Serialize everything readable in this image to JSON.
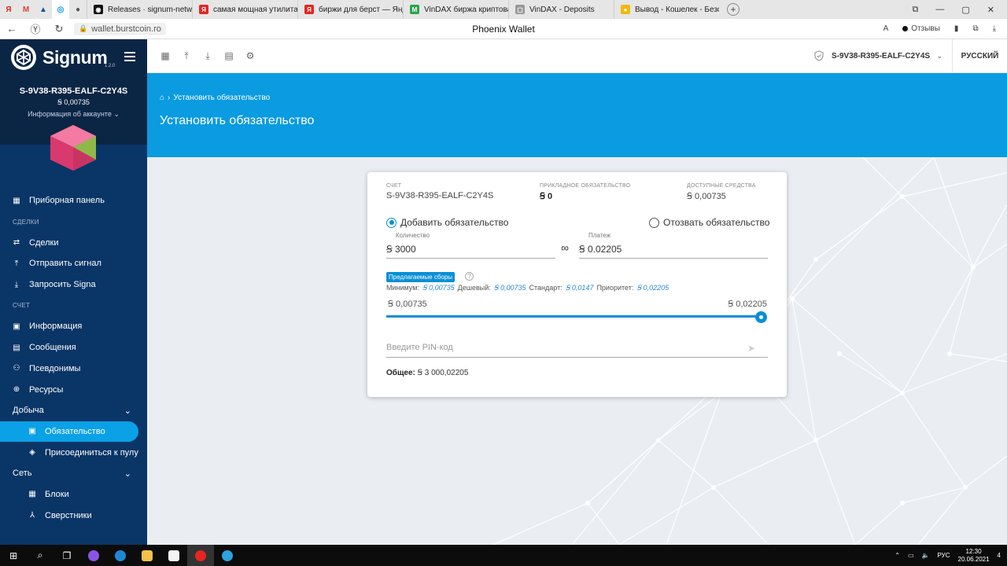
{
  "browser": {
    "pinned": [
      {
        "label": "Я",
        "color": "#e52620"
      },
      {
        "label": "M",
        "color": "#d44638"
      },
      {
        "label": "▲",
        "color": "#1a4fa0"
      },
      {
        "label": "◎",
        "color": "#0a9be1"
      },
      {
        "label": "●",
        "color": "#555555"
      }
    ],
    "tabs": [
      {
        "label": "Releases · signum-network",
        "fav": "◉",
        "fav_color": "#111111"
      },
      {
        "label": "самая мощная утилита для",
        "fav": "Я",
        "fav_color": "#e52620"
      },
      {
        "label": "биржи для берст — Яндекс",
        "fav": "Я",
        "fav_color": "#e52620"
      },
      {
        "label": "VinDAX биржа криптовалют",
        "fav": "M",
        "fav_color": "#2ca44e"
      },
      {
        "label": "VinDAX - Deposits",
        "fav": "▢",
        "fav_color": "#999999"
      },
      {
        "label": "Вывод - Кошелек - Безопа",
        "fav": "●",
        "fav_color": "#f0b90b"
      }
    ],
    "new_tab": "+",
    "window_controls": [
      "⧉",
      "—",
      "▢",
      "✕"
    ],
    "url": "wallet.burstcoin.ro",
    "page_title": "Phoenix Wallet",
    "reviews": "Отзывы"
  },
  "sidebar": {
    "logo": "Signum",
    "version": "1.2.0",
    "account_id": "S-9V38-R395-EALF-C2Y4S",
    "balance": "Ꞩ 0,00735",
    "account_info": "Информация об аккаунте ⌄",
    "dashboard": "Приборная панель",
    "section_deals": "СДЕЛКИ",
    "deals": "Сделки",
    "send": "Отправить сигнал",
    "request": "Запросить Signa",
    "section_account": "СЧЕТ",
    "info": "Информация",
    "messages": "Сообщения",
    "aliases": "Псевдонимы",
    "assets": "Ресурсы",
    "mining": "Добыча",
    "commitment": "Обязательство",
    "join_pool": "Присоединиться к пулу",
    "network": "Сеть",
    "blocks": "Блоки",
    "peers": "Сверстники"
  },
  "topbar": {
    "account": "S-9V38-R395-EALF-C2Y4S",
    "language": "РУССКИЙ"
  },
  "hero": {
    "breadcrumb": "Установить обязательство",
    "title": "Установить обязательство"
  },
  "form": {
    "account_label": "СЧЕТ",
    "account_value": "S-9V38-R395-EALF-C2Y4S",
    "committed_label": "ПРИКЛАДНОЕ ОБЯЗАТЕЛЬСТВО",
    "committed_value": "Ꞩ 0",
    "available_label": "ДОСТУПНЫЕ СРЕДСТВА",
    "available_value": "Ꞩ 0,00735",
    "add_label": "Добавить обязательство",
    "revoke_label": "Отозвать обязательство",
    "add_selected": true,
    "amount_label": "Количество",
    "amount_value": "Ꞩ 3000",
    "infinity": "∞",
    "fee_label": "Платеж",
    "fee_value": "Ꞩ 0.02205",
    "suggested_fees": "Предлагаемые сборы",
    "help": "?",
    "min_label": "Минимум:",
    "min_value": "Ꞩ 0,00735",
    "cheap_label": "Дешевый:",
    "cheap_value": "Ꞩ 0,00735",
    "standard_label": "Стандарт:",
    "standard_value": "Ꞩ 0,0147",
    "priority_label": "Приоритет:",
    "priority_value": "Ꞩ 0,02205",
    "range_min": "Ꞩ 0,00735",
    "range_max": "Ꞩ 0,02205",
    "slider_position": 1.0,
    "pin_placeholder": "Введите PIN-код",
    "total_label": "Общее:",
    "total_value": "Ꞩ 3 000,02205"
  },
  "taskbar": {
    "lang": "РУС",
    "time": "12:30",
    "date": "20.06.2021",
    "notifications": "4"
  },
  "colors": {
    "sidebar_bg": "#0a3567",
    "sidebar_head": "#0b2545",
    "accent": "#0a9be1",
    "active_item": "#0aa1e6"
  }
}
